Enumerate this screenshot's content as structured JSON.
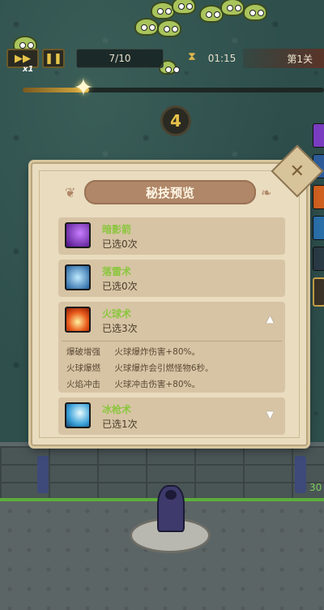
{
  "hud": {
    "speed_multiplier": "x1",
    "wave_progress": "7/10",
    "timer": "01:15",
    "level": "第1关",
    "countdown": "4",
    "hp_partial": "30"
  },
  "modal": {
    "title": "秘技预览",
    "skills": [
      {
        "name": "暗影箭",
        "count": "已选0次",
        "icon": "shadow-arrow-icon",
        "color": "#6b2fb0"
      },
      {
        "name": "落雷术",
        "count": "已选0次",
        "icon": "lightning-icon",
        "color": "#2c7fc2"
      },
      {
        "name": "火球术",
        "count": "已选3次",
        "icon": "fireball-icon",
        "color": "#e0561a",
        "expanded": true
      },
      {
        "name": "冰枪术",
        "count": "已选1次",
        "icon": "ice-spear-icon",
        "color": "#3da0d6"
      }
    ],
    "fireball_details": [
      {
        "name": "爆破增强",
        "desc": "火球爆炸伤害+80%。"
      },
      {
        "name": "火球爆燃",
        "desc": "火球爆炸会引燃怪物6秒。"
      },
      {
        "name": "火焰冲击",
        "desc": "火球冲击伤害+80%。"
      }
    ]
  }
}
